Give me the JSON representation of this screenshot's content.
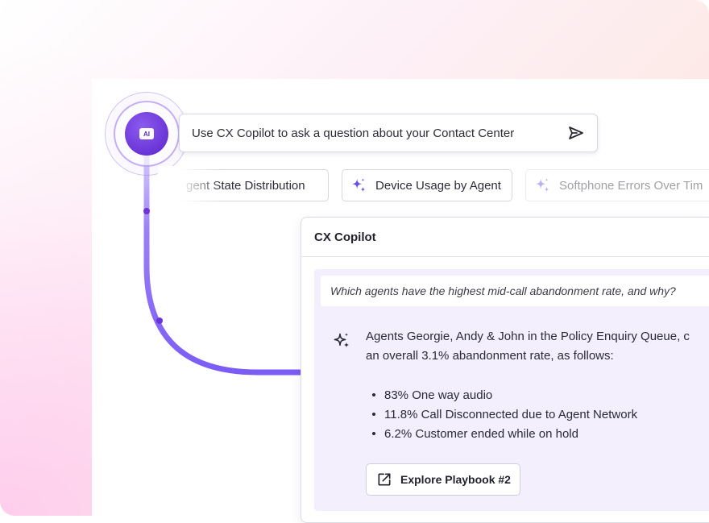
{
  "orb": {
    "badge": "AI",
    "icon": "ai-badge-icon"
  },
  "search": {
    "placeholder": "Use CX Copilot to ask a question about your Contact Center",
    "send_icon": "send-icon"
  },
  "suggestions": [
    {
      "label": "gent State Distribution"
    },
    {
      "label": "Device Usage by Agent",
      "icon": "sparkle-icon"
    },
    {
      "label": "Softphone Errors Over Tim",
      "icon": "sparkle-icon"
    }
  ],
  "copilot": {
    "title": "CX Copilot",
    "question": "Which agents have the highest mid-call abandonment rate, and why?",
    "answer_line1": "Agents Georgie, Andy & John in the Policy Enquiry Queue, c",
    "answer_line2": "an overall 3.1% abandonment rate, as follows:",
    "bullets": [
      "83% One way audio",
      "11.8% Call Disconnected due to Agent Network",
      "6.2% Customer ended while on hold"
    ],
    "playbook_label": "Explore Playbook #2"
  },
  "colors": {
    "accent": "#6a34d6",
    "connector": "#7b5cf5",
    "chat_bg": "#f3effd"
  }
}
